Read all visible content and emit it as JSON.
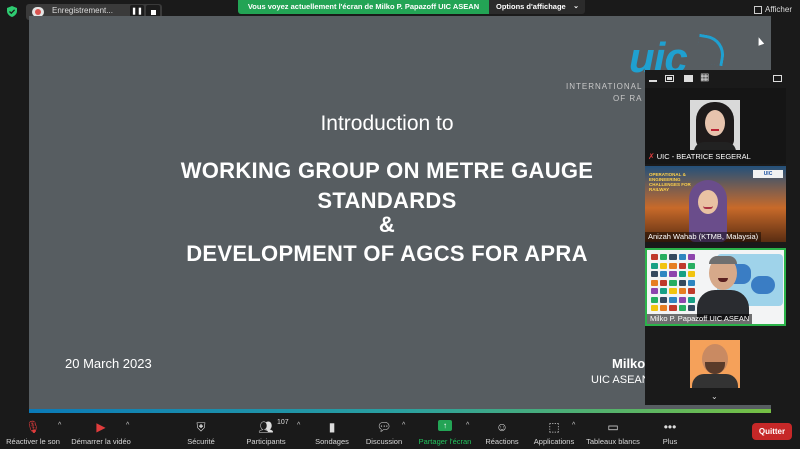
{
  "top_bar": {
    "recording_label": "Enregistrement...",
    "share_banner": "Vous voyez actuellement l'écran de Milko P. Papazoff UIC ASEAN",
    "view_options_label": "Options d'affichage",
    "show_label": "Afficher"
  },
  "slide": {
    "logo_text": "uic",
    "logo_line1": "INTERNATIONAL",
    "logo_line2": "OF RA",
    "intro": "Introduction to",
    "heading_line1": "WORKING GROUP ON METRE GAUGE",
    "heading_line2": "STANDARDS",
    "heading_line3": "&",
    "heading_line4": "DEVELOPMENT OF AGCS FOR  APRA",
    "date": "20 March 2023",
    "presenter_name": "Milko",
    "presenter_org": "UIC ASEAN"
  },
  "gallery": {
    "tiles": [
      {
        "name": "UIC - BEATRICE SEGERAL",
        "muted": true
      },
      {
        "name": "Anizah Wahab (KTMB, Malaysia)",
        "poster_title": "OPERATIONAL & ENGINEERING CHALLENGES FOR RAILWAY",
        "badge": "UIC"
      },
      {
        "name": "Milko P. Papazoff UIC ASEAN",
        "active_speaker": true
      },
      {
        "name": ""
      }
    ]
  },
  "toolbar": {
    "mute_label": "Réactiver le son",
    "video_label": "Démarrer la vidéo",
    "security_label": "Sécurité",
    "participants_label": "Participants",
    "participants_count": "107",
    "polls_label": "Sondages",
    "discussion_label": "Discussion",
    "share_label": "Partager l'écran",
    "reactions_label": "Réactions",
    "apps_label": "Applications",
    "whiteboards_label": "Tableaux blancs",
    "more_label": "Plus",
    "quit_label": "Quitter"
  },
  "icons": {
    "mute": "muted-microphone-icon",
    "video": "video-off-icon",
    "security": "shield-icon",
    "participants": "people-icon",
    "polls": "bar-chart-icon",
    "discussion": "chat-bubble-icon",
    "share": "share-screen-icon",
    "reactions": "emoji-icon",
    "apps": "apps-icon",
    "whiteboards": "whiteboard-icon",
    "more": "more-dots-icon"
  },
  "colors": {
    "share_green": "#23a455",
    "quit_red": "#c62828",
    "slide_bg": "#575d61",
    "uic_blue": "#1fa0d0"
  }
}
